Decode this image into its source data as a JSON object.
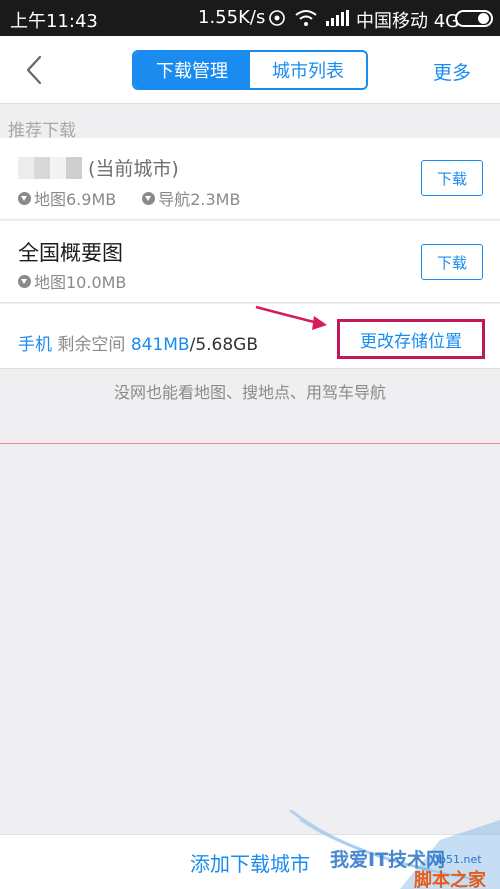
{
  "status_bar": {
    "time": "上午11:43",
    "speed": "1.55K/s",
    "carrier": "中国移动 4G"
  },
  "nav": {
    "tabs": [
      {
        "label": "下载管理",
        "active": true
      },
      {
        "label": "城市列表",
        "active": false
      }
    ],
    "more": "更多"
  },
  "section": {
    "recommend_label": "推荐下载"
  },
  "items": [
    {
      "title": "(当前城市)",
      "map_size": "地图6.9MB",
      "nav_size": "导航2.3MB",
      "button": "下载"
    },
    {
      "title": "全国概要图",
      "map_size": "地图10.0MB",
      "button": "下载"
    }
  ],
  "storage": {
    "device": "手机",
    "remaining_label": "剩余空间",
    "remaining": "841MB",
    "total": "/5.68GB",
    "change_button": "更改存储位置"
  },
  "tip": "没网也能看地图、搜地点、用驾车导航",
  "bottom": {
    "add_button": "添加下载城市"
  },
  "watermark": {
    "text1": "我爱IT技术网",
    "text2": "jb51.net",
    "text3": "脚本之家"
  },
  "colors": {
    "accent": "#1a8cf0",
    "highlight_box": "#c2185b",
    "annotation_arrow": "#d81b60"
  }
}
